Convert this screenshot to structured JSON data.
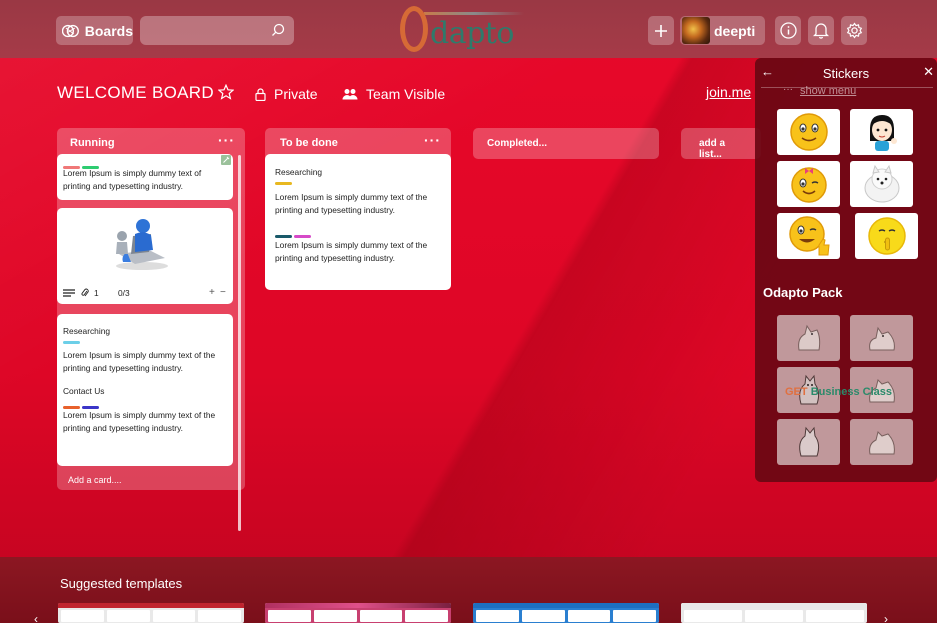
{
  "header": {
    "boards_label": "Boards",
    "search_placeholder": "",
    "logo_text": "dapto",
    "user_name": "deepti"
  },
  "board": {
    "title": "WELCOME BOARD",
    "privacy": "Private",
    "visibility": "Team Visible",
    "join_link": "join.me"
  },
  "lists": [
    {
      "title": "Running",
      "menu": "···",
      "cards": [
        {
          "labels": [
            "#f07878",
            "#2ecc71"
          ],
          "text": "Lorem Ipsum is simply dummy text of printing and typesetting industry."
        },
        {
          "image": "figure-at-laptop",
          "badges": {
            "attachments": "1",
            "checklist": "0/3"
          }
        },
        {
          "title": "Researching",
          "labels": [
            "#6ccfe8"
          ],
          "text": "Lorem Ipsum is simply dummy text of the printing and typesetting industry.",
          "title2": "Contact Us",
          "labels2": [
            "#e8612c",
            "#3b35c8"
          ],
          "text2": "Lorem Ipsum is simply dummy text of the printing and typesetting industry."
        }
      ],
      "add_card": "Add a card...."
    },
    {
      "title": "To be done",
      "menu": "···",
      "cards": [
        {
          "title": "Researching",
          "labels": [
            "#e8b820"
          ],
          "text": "Lorem Ipsum is simply dummy text of the printing and typesetting industry.",
          "labels2": [
            "#1a5a6a",
            "#d64ac8"
          ],
          "text2": "Lorem Ipsum is simply dummy text of the printing and typesetting industry."
        }
      ]
    },
    {
      "title": "Completed..."
    },
    {
      "title": "add a list..."
    }
  ],
  "stickers_panel": {
    "title": "Stickers",
    "show_menu": "show menu",
    "show_dots": "···",
    "stickers": [
      "smiley-face",
      "girl-cartoon",
      "winking-smiley",
      "white-dog",
      "thumbs-up-smiley",
      "shush-smiley"
    ],
    "pack_title": "Odapto Pack",
    "pack_overlay_get": "GET",
    "pack_overlay_rest": "Business Class"
  },
  "templates": {
    "title": "Suggested templates"
  }
}
